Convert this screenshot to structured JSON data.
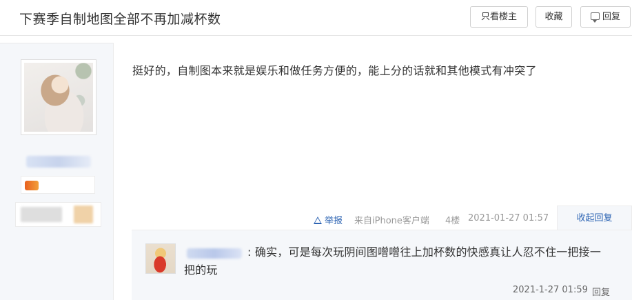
{
  "header": {
    "title": "下赛季自制地图全部不再加减杯数",
    "buttons": {
      "only_op": "只看楼主",
      "favorite": "收藏",
      "reply": "回复"
    }
  },
  "post": {
    "content": "挺好的，自制图本来就是娱乐和做任务方便的，能上分的话就和其他模式有冲突了",
    "report_label": "举报",
    "source": "来自iPhone客户端",
    "floor": "4楼",
    "time": "2021-01-27 01:57",
    "collapse_label": "收起回复"
  },
  "subreply": {
    "text": ": 确实，可是每次玩阴间图噌噌往上加杯数的快感真让人忍不住一把接一把的玩",
    "time": "2021-1-27 01:59",
    "reply_label": "回复"
  },
  "colors": {
    "link": "#2d64b3",
    "sidebar_bg": "#f5f7fa"
  }
}
